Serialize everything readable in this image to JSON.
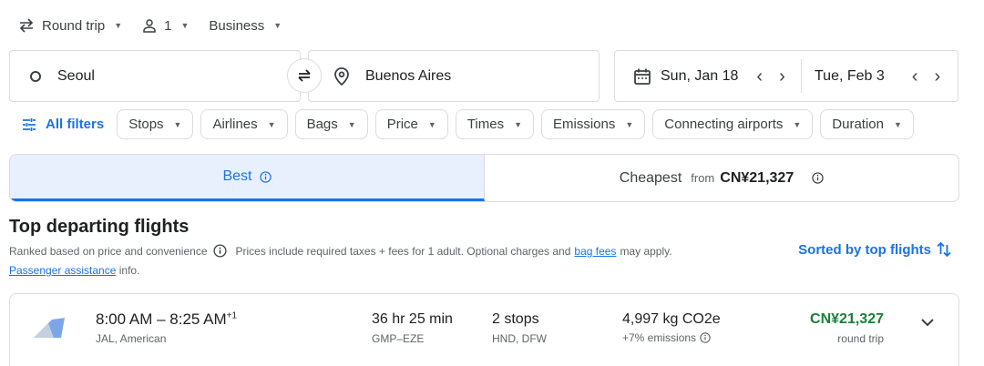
{
  "selectors": {
    "trip_type": "Round trip",
    "passengers": "1",
    "cabin": "Business"
  },
  "search": {
    "origin": "Seoul",
    "destination": "Buenos Aires",
    "depart_date": "Sun, Jan 18",
    "return_date": "Tue, Feb 3"
  },
  "filters": {
    "all_label": "All filters",
    "chips": [
      "Stops",
      "Airlines",
      "Bags",
      "Price",
      "Times",
      "Emissions",
      "Connecting airports",
      "Duration"
    ]
  },
  "tabs": {
    "best": "Best",
    "cheapest": "Cheapest",
    "from_label": "from",
    "cheapest_price": "CN¥21,327"
  },
  "section": {
    "title": "Top departing flights",
    "ranked_text": "Ranked based on price and convenience",
    "prices_text": "Prices include required taxes + fees for 1 adult. Optional charges and",
    "bag_fees_link": "bag fees",
    "may_apply": "may apply.",
    "passenger_link": "Passenger assistance",
    "info_text": "info.",
    "sorted_label": "Sorted by top flights"
  },
  "flights": [
    {
      "times": "8:00 AM – 8:25 AM",
      "day_offset": "+1",
      "airlines": "JAL, American",
      "duration": "36 hr 25 min",
      "route": "GMP–EZE",
      "stops": "2 stops",
      "via": "HND, DFW",
      "emissions": "4,997 kg CO2e",
      "emissions_delta": "+7% emissions",
      "price": "CN¥21,327",
      "price_type": "round trip"
    }
  ],
  "colors": {
    "accent": "#1a73e8",
    "price_green": "#188038",
    "tab_selected_bg": "#e8f0fe",
    "border": "#dadce0"
  }
}
